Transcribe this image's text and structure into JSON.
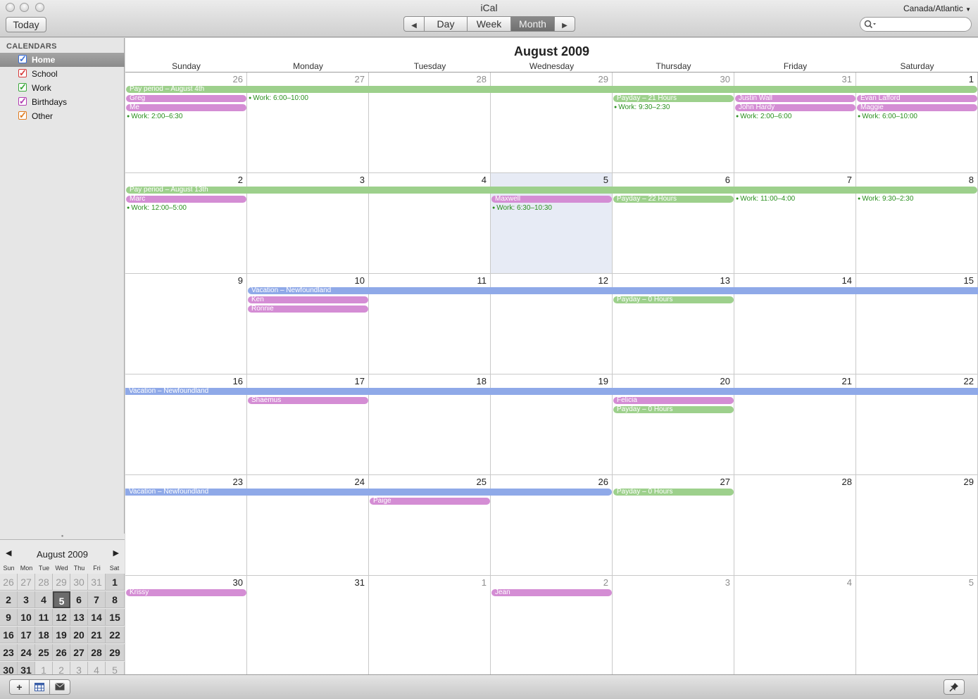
{
  "window": {
    "title": "iCal"
  },
  "toolbar": {
    "today_label": "Today",
    "view_day": "Day",
    "view_week": "Week",
    "view_month": "Month",
    "active_view": "Month",
    "timezone": "Canada/Atlantic",
    "search_value": "",
    "search_placeholder": ""
  },
  "sidebar": {
    "header": "CALENDARS",
    "calendars": [
      {
        "label": "Home",
        "color": "#3b6fd8",
        "checked": true,
        "selected": true
      },
      {
        "label": "School",
        "color": "#d83b3b",
        "checked": true,
        "selected": false
      },
      {
        "label": "Work",
        "color": "#3ba83b",
        "checked": true,
        "selected": false
      },
      {
        "label": "Birthdays",
        "color": "#b23bb2",
        "checked": true,
        "selected": false
      },
      {
        "label": "Other",
        "color": "#e07b1f",
        "checked": true,
        "selected": false
      }
    ]
  },
  "mini_calendar": {
    "title": "August 2009",
    "weekdays": [
      "Sun",
      "Mon",
      "Tue",
      "Wed",
      "Thu",
      "Fri",
      "Sat"
    ],
    "days": [
      "26",
      "27",
      "28",
      "29",
      "30",
      "31",
      "1",
      "2",
      "3",
      "4",
      "5",
      "6",
      "7",
      "8",
      "9",
      "10",
      "11",
      "12",
      "13",
      "14",
      "15",
      "16",
      "17",
      "18",
      "19",
      "20",
      "21",
      "22",
      "23",
      "24",
      "25",
      "26",
      "27",
      "28",
      "29",
      "30",
      "31",
      "1",
      "2",
      "3",
      "4",
      "5"
    ],
    "other_month": [
      0,
      1,
      2,
      3,
      4,
      5,
      37,
      38,
      39,
      40,
      41
    ],
    "today_index": 10
  },
  "month_view": {
    "title": "August 2009",
    "weekdays": [
      "Sunday",
      "Monday",
      "Tuesday",
      "Wednesday",
      "Thursday",
      "Friday",
      "Saturday"
    ],
    "days": [
      "26",
      "27",
      "28",
      "29",
      "30",
      "31",
      "1",
      "2",
      "3",
      "4",
      "5",
      "6",
      "7",
      "8",
      "9",
      "10",
      "11",
      "12",
      "13",
      "14",
      "15",
      "16",
      "17",
      "18",
      "19",
      "20",
      "21",
      "22",
      "23",
      "24",
      "25",
      "26",
      "27",
      "28",
      "29",
      "30",
      "31",
      "1",
      "2",
      "3",
      "4",
      "5"
    ],
    "other_month": [
      0,
      1,
      2,
      3,
      4,
      5,
      37,
      38,
      39,
      40,
      41
    ],
    "today_index": 10,
    "events": [
      {
        "title": "Pay period – August 4th",
        "style": "green",
        "week": 0,
        "start": 0,
        "end": 6,
        "slot": 0
      },
      {
        "title": "Greg",
        "style": "pink",
        "week": 0,
        "start": 0,
        "end": 0,
        "slot": 1
      },
      {
        "title": "Me",
        "style": "pink",
        "week": 0,
        "start": 0,
        "end": 0,
        "slot": 2
      },
      {
        "title": "Work: 2:00–6:30",
        "style": "dot",
        "week": 0,
        "start": 0,
        "end": 0,
        "slot": 3
      },
      {
        "title": "Work: 6:00–10:00",
        "style": "dot",
        "week": 0,
        "start": 1,
        "end": 1,
        "slot": 1
      },
      {
        "title": "Payday – 21 Hours",
        "style": "green",
        "week": 0,
        "start": 4,
        "end": 4,
        "slot": 1
      },
      {
        "title": "Work: 9:30–2:30",
        "style": "dot",
        "week": 0,
        "start": 4,
        "end": 4,
        "slot": 2
      },
      {
        "title": "Justin Wall",
        "style": "pink",
        "week": 0,
        "start": 5,
        "end": 5,
        "slot": 1
      },
      {
        "title": "John Hardy",
        "style": "pink",
        "week": 0,
        "start": 5,
        "end": 5,
        "slot": 2
      },
      {
        "title": "Work: 2:00–6:00",
        "style": "dot",
        "week": 0,
        "start": 5,
        "end": 5,
        "slot": 3
      },
      {
        "title": "Evan Lafford",
        "style": "pink",
        "week": 0,
        "start": 6,
        "end": 6,
        "slot": 1
      },
      {
        "title": "Maggie",
        "style": "pink",
        "week": 0,
        "start": 6,
        "end": 6,
        "slot": 2
      },
      {
        "title": "Work: 6:00–10:00",
        "style": "dot",
        "week": 0,
        "start": 6,
        "end": 6,
        "slot": 3
      },
      {
        "title": "Pay period – August 13th",
        "style": "green",
        "week": 1,
        "start": 0,
        "end": 6,
        "slot": 0
      },
      {
        "title": "Marc",
        "style": "pink",
        "week": 1,
        "start": 0,
        "end": 0,
        "slot": 1
      },
      {
        "title": "Work: 12:00–5:00",
        "style": "dot",
        "week": 1,
        "start": 0,
        "end": 0,
        "slot": 2
      },
      {
        "title": "Maxwell",
        "style": "pink",
        "week": 1,
        "start": 3,
        "end": 3,
        "slot": 1
      },
      {
        "title": "Work: 6:30–10:30",
        "style": "dot",
        "week": 1,
        "start": 3,
        "end": 3,
        "slot": 2
      },
      {
        "title": "Payday – 22 Hours",
        "style": "green",
        "week": 1,
        "start": 4,
        "end": 4,
        "slot": 1
      },
      {
        "title": "Work: 11:00–4:00",
        "style": "dot",
        "week": 1,
        "start": 5,
        "end": 5,
        "slot": 1
      },
      {
        "title": "Work: 9:30–2:30",
        "style": "dot",
        "week": 1,
        "start": 6,
        "end": 6,
        "slot": 1
      },
      {
        "title": "Vacation – Newfoundland",
        "style": "blue",
        "week": 2,
        "start": 1,
        "end": 6,
        "slot": 0,
        "continues": true
      },
      {
        "title": "Ken",
        "style": "pink",
        "week": 2,
        "start": 1,
        "end": 1,
        "slot": 1
      },
      {
        "title": "Ronnie",
        "style": "pink",
        "week": 2,
        "start": 1,
        "end": 1,
        "slot": 2
      },
      {
        "title": "Payday – 0 Hours",
        "style": "green",
        "week": 2,
        "start": 4,
        "end": 4,
        "slot": 1
      },
      {
        "title": "Vacation – Newfoundland",
        "style": "blue",
        "week": 3,
        "start": 0,
        "end": 6,
        "slot": 0,
        "continued": true,
        "continues": true
      },
      {
        "title": "Shaemus",
        "style": "pink",
        "week": 3,
        "start": 1,
        "end": 1,
        "slot": 1
      },
      {
        "title": "Felicia",
        "style": "pink",
        "week": 3,
        "start": 4,
        "end": 4,
        "slot": 1
      },
      {
        "title": "Payday – 0 Hours",
        "style": "green",
        "week": 3,
        "start": 4,
        "end": 4,
        "slot": 2
      },
      {
        "title": "Vacation – Newfoundland",
        "style": "blue",
        "week": 4,
        "start": 0,
        "end": 3,
        "slot": 0,
        "continued": true
      },
      {
        "title": "Payday – 0 Hours",
        "style": "green",
        "week": 4,
        "start": 4,
        "end": 4,
        "slot": 0
      },
      {
        "title": "Paige",
        "style": "pink",
        "week": 4,
        "start": 2,
        "end": 2,
        "slot": 1
      },
      {
        "title": "Krissy",
        "style": "pink",
        "week": 5,
        "start": 0,
        "end": 0,
        "slot": 0
      },
      {
        "title": "Jean",
        "style": "pink",
        "week": 5,
        "start": 3,
        "end": 3,
        "slot": 0
      }
    ]
  },
  "bottom_bar": {
    "add_label": "+"
  }
}
